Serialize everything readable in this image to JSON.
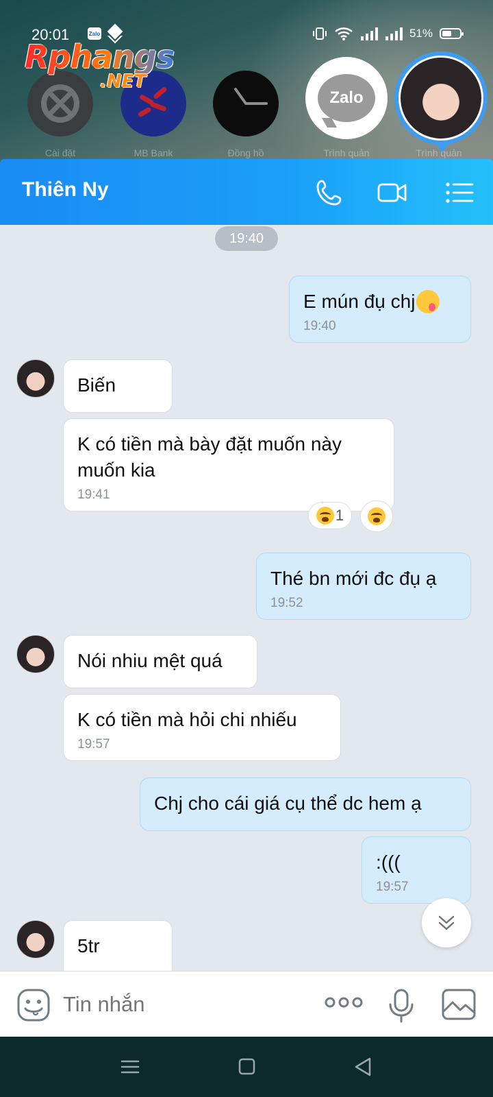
{
  "status_bar": {
    "time": "20:01",
    "battery": "51%"
  },
  "watermark": {
    "main": "Rphangs",
    "sub": ".NET"
  },
  "bubbles": [
    {
      "label": "Cài đặt"
    },
    {
      "label": "MB Bank"
    },
    {
      "label": "Đồng hồ"
    },
    {
      "label": "Trình quản"
    },
    {
      "label": "Trình quản"
    }
  ],
  "zalo_bubble_text": "Zalo",
  "header": {
    "title": "Thiên Ny"
  },
  "chat": {
    "date_chip": "19:40",
    "messages": [
      {
        "dir": "out",
        "text": "E mún đụ chj",
        "time": "19:40"
      },
      {
        "dir": "in",
        "text": "Biến"
      },
      {
        "dir": "in",
        "text": "K có tiền mà bày đặt muốn này muốn kia",
        "time": "19:41",
        "reaction_count": "1"
      },
      {
        "dir": "out",
        "text": "Thé bn mới đc đụ ạ",
        "time": "19:52"
      },
      {
        "dir": "in",
        "text": "Nói nhiu mệt quá"
      },
      {
        "dir": "in",
        "text": "K có tiền mà hỏi chi nhiếu",
        "time": "19:57"
      },
      {
        "dir": "out",
        "text": "Chj cho cái giá cụ thể dc hem ạ"
      },
      {
        "dir": "out",
        "text": ":(((",
        "time": "19:57"
      },
      {
        "dir": "in",
        "text": "5tr"
      }
    ]
  },
  "input": {
    "placeholder": "Tin nhắn"
  },
  "colors": {
    "header_start": "#1a8cf5",
    "header_end": "#24c0fb",
    "outgoing_bubble": "#d5ecfd",
    "chat_bg": "#e3e8ef"
  }
}
